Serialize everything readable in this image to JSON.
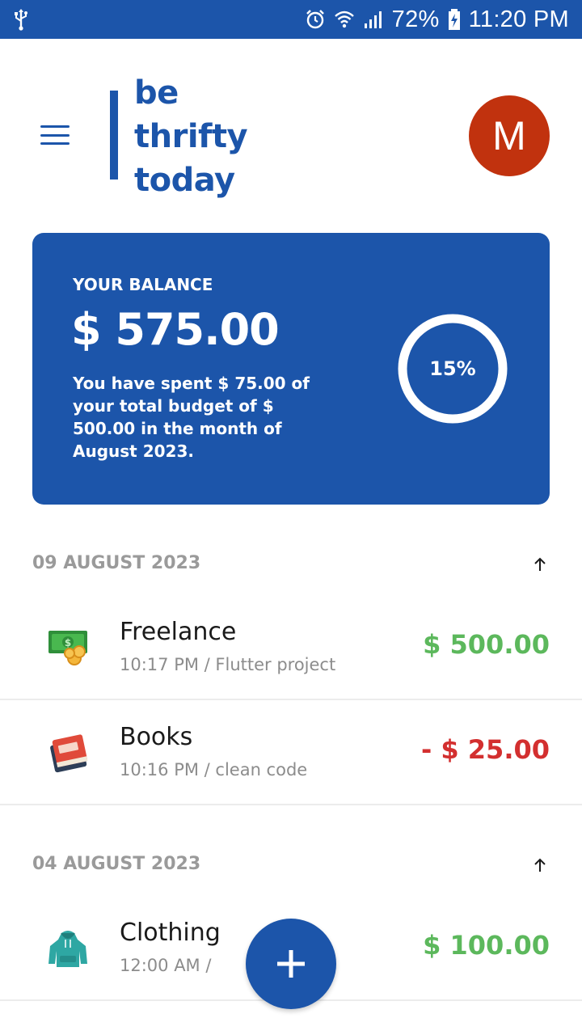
{
  "status_bar": {
    "battery": "72%",
    "time": "11:20 PM",
    "icons": [
      "usb-icon",
      "alarm-icon",
      "wifi-icon",
      "signal-icon",
      "battery-charging-icon"
    ]
  },
  "header": {
    "logo_lines": [
      "be",
      "thrifty",
      "today"
    ],
    "avatar_initial": "M"
  },
  "balance": {
    "label": "YOUR BALANCE",
    "amount": "$ 575.00",
    "description": "You have spent $ 75.00 of your total budget of $ 500.00 in the month of August 2023.",
    "percent_label": "15%",
    "percent_value": 15
  },
  "groups": [
    {
      "date": "09 AUGUST 2023",
      "transactions": [
        {
          "title": "Freelance",
          "subtitle": "10:17 PM / Flutter project",
          "amount": "$ 500.00",
          "type": "income",
          "icon": "money-icon"
        },
        {
          "title": "Books",
          "subtitle": "10:16 PM / clean code",
          "amount": "- $ 25.00",
          "type": "expense",
          "icon": "book-icon"
        }
      ]
    },
    {
      "date": "04 AUGUST 2023",
      "transactions": [
        {
          "title": "Clothing",
          "subtitle": "12:00 AM /",
          "amount": "$ 100.00",
          "type": "income",
          "icon": "hoodie-icon"
        }
      ]
    }
  ],
  "colors": {
    "primary": "#1c55aa",
    "avatar": "#c1320e",
    "income": "#5cb85c",
    "expense": "#d32f2f",
    "muted": "#9a9a9a"
  }
}
